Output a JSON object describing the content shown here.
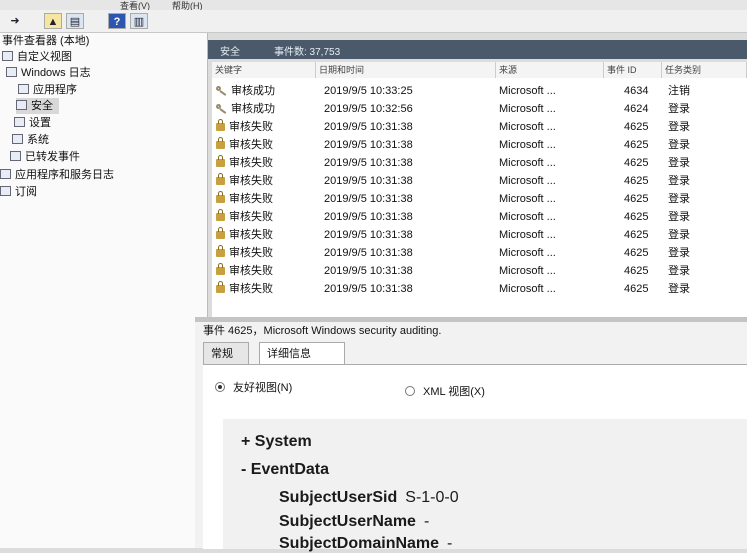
{
  "menu": [
    "查看(V)",
    "帮助(H)"
  ],
  "toolbar": {
    "back_icon": "arrow-icon",
    "up_icon": "up-folder-icon",
    "help_label": "?"
  },
  "tree": {
    "root": "事件查看器 (本地)",
    "items": [
      {
        "label": "自定义视图",
        "icon": "funnel-icon"
      },
      {
        "label": "Windows 日志",
        "icon": "log-folder-icon"
      },
      {
        "label": "应用程序",
        "icon": "log-icon"
      },
      {
        "label": "安全",
        "icon": "log-icon"
      },
      {
        "label": "设置",
        "icon": "log-icon"
      },
      {
        "label": "系统",
        "icon": "log-icon"
      },
      {
        "label": "已转发事件",
        "icon": "log-icon"
      },
      {
        "label": "应用程序和服务日志",
        "icon": "folder-icon"
      },
      {
        "label": "订阅",
        "icon": "subscription-icon"
      }
    ]
  },
  "log_header": {
    "title": "安全",
    "count": "事件数: 37,753"
  },
  "table": {
    "columns": [
      "关键字",
      "日期和时间",
      "来源",
      "事件 ID",
      "任务类别"
    ],
    "rows": [
      {
        "keyword": "审核成功",
        "datetime": "2019/9/5 10:33:25",
        "source": "Microsoft ...",
        "id": "4634",
        "task": "注销",
        "icon": "key-icon"
      },
      {
        "keyword": "审核成功",
        "datetime": "2019/9/5 10:32:56",
        "source": "Microsoft ...",
        "id": "4624",
        "task": "登录",
        "icon": "key-icon"
      },
      {
        "keyword": "审核失败",
        "datetime": "2019/9/5 10:31:38",
        "source": "Microsoft ...",
        "id": "4625",
        "task": "登录",
        "icon": "lock-icon"
      },
      {
        "keyword": "审核失败",
        "datetime": "2019/9/5 10:31:38",
        "source": "Microsoft ...",
        "id": "4625",
        "task": "登录",
        "icon": "lock-icon"
      },
      {
        "keyword": "审核失败",
        "datetime": "2019/9/5 10:31:38",
        "source": "Microsoft ...",
        "id": "4625",
        "task": "登录",
        "icon": "lock-icon"
      },
      {
        "keyword": "审核失败",
        "datetime": "2019/9/5 10:31:38",
        "source": "Microsoft ...",
        "id": "4625",
        "task": "登录",
        "icon": "lock-icon"
      },
      {
        "keyword": "审核失败",
        "datetime": "2019/9/5 10:31:38",
        "source": "Microsoft ...",
        "id": "4625",
        "task": "登录",
        "icon": "lock-icon"
      },
      {
        "keyword": "审核失败",
        "datetime": "2019/9/5 10:31:38",
        "source": "Microsoft ...",
        "id": "4625",
        "task": "登录",
        "icon": "lock-icon"
      },
      {
        "keyword": "审核失败",
        "datetime": "2019/9/5 10:31:38",
        "source": "Microsoft ...",
        "id": "4625",
        "task": "登录",
        "icon": "lock-icon"
      },
      {
        "keyword": "审核失败",
        "datetime": "2019/9/5 10:31:38",
        "source": "Microsoft ...",
        "id": "4625",
        "task": "登录",
        "icon": "lock-icon"
      },
      {
        "keyword": "审核失败",
        "datetime": "2019/9/5 10:31:38",
        "source": "Microsoft ...",
        "id": "4625",
        "task": "登录",
        "icon": "lock-icon"
      },
      {
        "keyword": "审核失败",
        "datetime": "2019/9/5 10:31:38",
        "source": "Microsoft ...",
        "id": "4625",
        "task": "登录",
        "icon": "lock-icon"
      }
    ]
  },
  "detail": {
    "title": "事件 4625，Microsoft Windows security auditing.",
    "tabs": [
      "常规",
      "详细信息"
    ],
    "active_tab": "详细信息",
    "view_options": [
      "友好视图(N)",
      "XML 视图(X)"
    ],
    "selected_view": "友好视图(N)",
    "tree": {
      "system": "+ System",
      "eventdata": "- EventData",
      "fields": [
        {
          "name": "SubjectUserSid",
          "value": "S-1-0-0"
        },
        {
          "name": "SubjectUserName",
          "value": "-"
        },
        {
          "name": "SubjectDomainName",
          "value": "-"
        }
      ]
    }
  },
  "colors": {
    "header_bg": "#4a5a6a",
    "lock": "#c8a040"
  }
}
